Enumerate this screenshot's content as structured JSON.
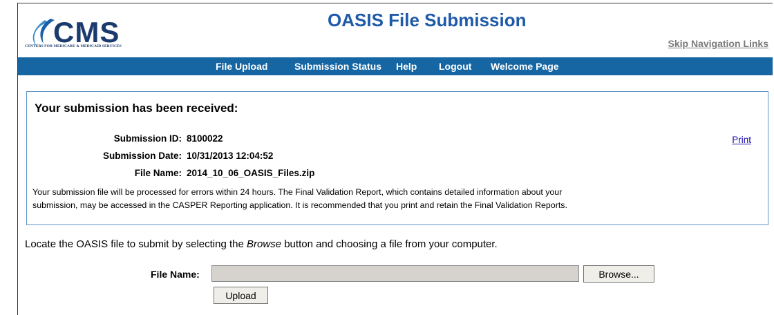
{
  "header": {
    "logo_text": "CMS",
    "logo_tagline": "CENTERS FOR MEDICARE & MEDICAID SERVICES",
    "title": "OASIS File Submission",
    "skip_link": "Skip Navigation Links"
  },
  "nav": {
    "items": [
      {
        "label": "File Upload"
      },
      {
        "label": "Submission Status"
      },
      {
        "label": "Help"
      },
      {
        "label": "Logout"
      },
      {
        "label": "Welcome Page"
      }
    ]
  },
  "confirmation": {
    "heading": "Your submission has been received:",
    "submission_id_label": "Submission ID:",
    "submission_id": "8100022",
    "submission_date_label": "Submission Date:",
    "submission_date": "10/31/2013 12:04:52",
    "file_name_label": "File Name:",
    "file_name": "2014_10_06_OASIS_Files.zip",
    "print_label": "Print",
    "info_line1": "Your submission file will be processed for errors within 24 hours. The Final Validation Report, which contains detailed information about your",
    "info_line2": "submission, may be accessed in the CASPER Reporting application. It is recommended that you print and retain the Final Validation Reports."
  },
  "upload": {
    "instruction_before": "Locate the OASIS file to submit by selecting the ",
    "instruction_emphasis": "Browse",
    "instruction_after": " button and choosing a file from your computer.",
    "file_label": "File Name:",
    "file_value": "",
    "browse_label": "Browse...",
    "upload_label": "Upload"
  },
  "colors": {
    "title_blue": "#1f5aa8",
    "nav_bar": "#1566a3",
    "box_border": "#5b8fc7",
    "logo_blue": "#1b3a6e",
    "logo_swoosh": "#3a8fd0"
  }
}
